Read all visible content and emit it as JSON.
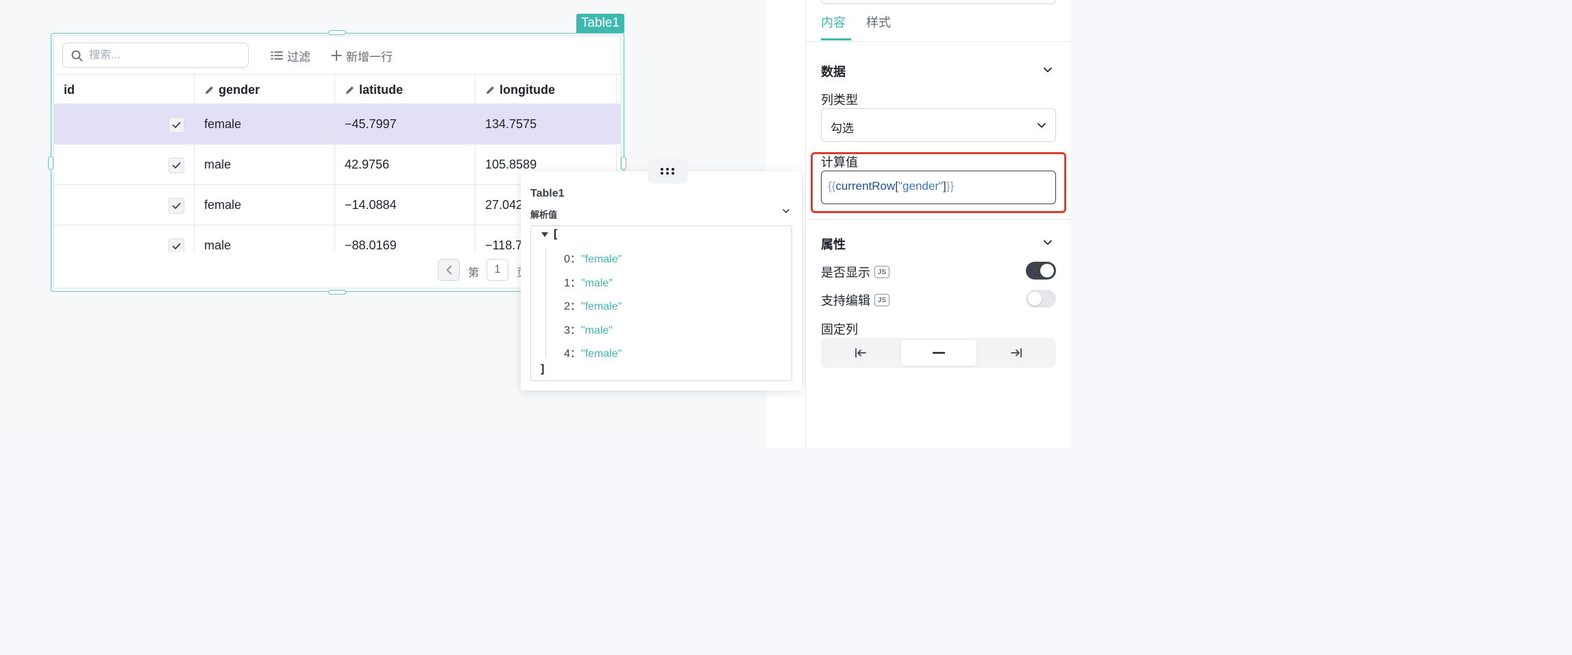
{
  "widget": {
    "name": "Table1"
  },
  "table": {
    "search_placeholder": "搜索...",
    "filter_label": "过滤",
    "add_row_label": "新增一行",
    "columns": [
      "id",
      "gender",
      "latitude",
      "longitude"
    ],
    "rows": [
      {
        "gender": "female",
        "latitude": "−45.7997",
        "longitude": "134.7575",
        "checked": true
      },
      {
        "gender": "male",
        "latitude": "42.9756",
        "longitude": "105.8589",
        "checked": true
      },
      {
        "gender": "female",
        "latitude": "−14.0884",
        "longitude": "27.042",
        "checked": true
      },
      {
        "gender": "male",
        "latitude": "−88.0169",
        "longitude": "−118.7",
        "checked": true
      }
    ],
    "pager": {
      "prefix": "第",
      "page": "1",
      "suffix": "页"
    }
  },
  "popover": {
    "title": "Table1",
    "subtitle": "解析值",
    "open_bracket": "[",
    "close_bracket": "]",
    "items": [
      {
        "key": "0",
        "value": "\"female\""
      },
      {
        "key": "1",
        "value": "\"male\""
      },
      {
        "key": "2",
        "value": "\"female\""
      },
      {
        "key": "3",
        "value": "\"male\""
      },
      {
        "key": "4",
        "value": "\"female\""
      }
    ],
    "colon": "："
  },
  "panel": {
    "tabs": [
      "内容",
      "样式"
    ],
    "active_tab": 0,
    "data_section": "数据",
    "column_type_label": "列类型",
    "column_type_value": "勾选",
    "computed_label": "计算值",
    "computed_code": {
      "open": "{{",
      "ident": "currentRow",
      "lb": "[",
      "str": "\"gender\"",
      "rb": "]",
      "close": "}}"
    },
    "props_section": "属性",
    "visible_label": "是否显示",
    "visible_on": true,
    "editable_label": "支持编辑",
    "editable_on": false,
    "fixed_label": "固定列",
    "fixed_options": [
      "fix-left",
      "none",
      "fix-right"
    ],
    "fixed_selected": 1,
    "js_badge": "JS"
  },
  "colors": {
    "accent": "#3fb9b0",
    "selected_row": "#e2e0f6",
    "highlight": "#e33b2b",
    "toggle_on": "#3d434d",
    "toggle_off": "#e5e6eb"
  }
}
